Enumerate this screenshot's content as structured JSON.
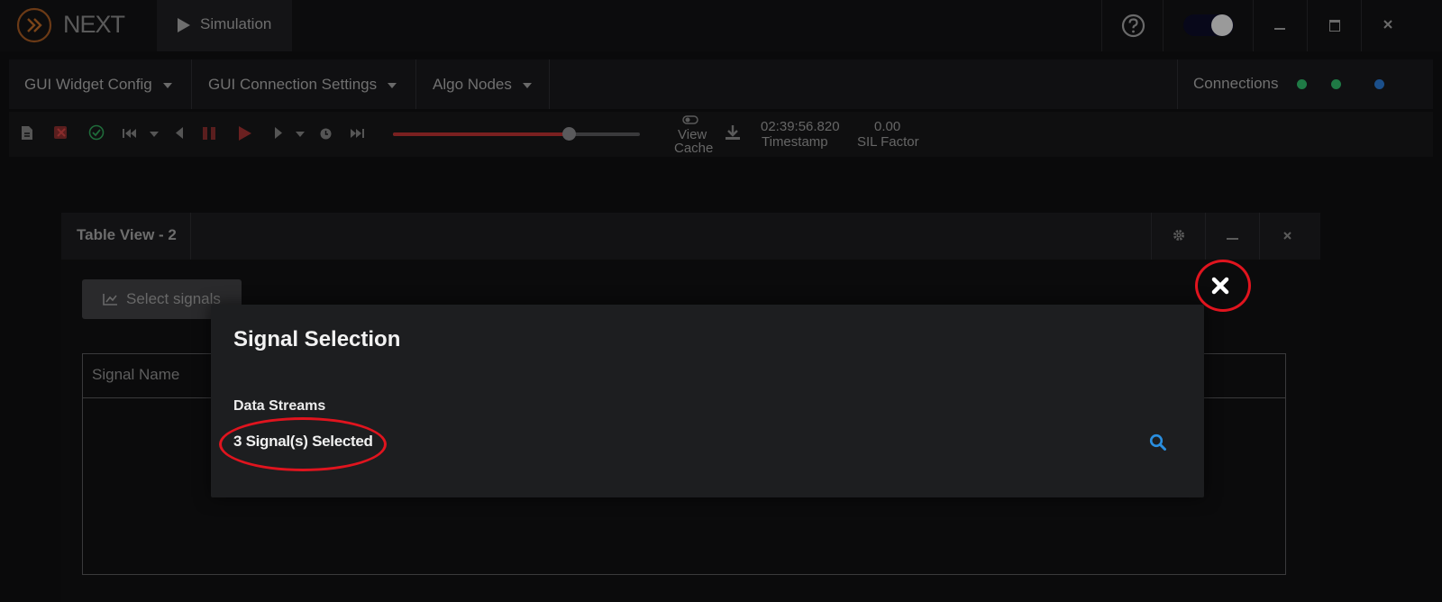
{
  "app": {
    "logo_text": "NEXT",
    "simulation_tab_label": "Simulation",
    "icons": [
      "logo-icon",
      "play-icon",
      "help-icon",
      "avatar-icon",
      "minimize-icon",
      "maximize-icon",
      "close-icon"
    ]
  },
  "menubar": {
    "items": [
      {
        "label": "GUI Widget Config"
      },
      {
        "label": "GUI Connection Settings"
      },
      {
        "label": "Algo Nodes"
      }
    ],
    "connections_label": "Connections",
    "connection_status_colors": [
      "#1f7a45",
      "#1f7a45",
      "#1b4f8a"
    ]
  },
  "toolbar": {
    "view_cache_line1": "View",
    "view_cache_line2": "Cache",
    "timestamp_value": "02:39:56.820",
    "timestamp_label": "Timestamp",
    "sil_value": "0.00",
    "sil_label": "SIL Factor",
    "progress_fraction": 0.71
  },
  "panel": {
    "title": "Table View - 2",
    "select_signals_label": "Select signals",
    "table_headers": [
      "Signal Name"
    ]
  },
  "modal": {
    "title": "Signal Selection",
    "data_streams_label": "Data Streams",
    "data_streams_value": "3 Signal(s) Selected"
  },
  "colors": {
    "annotation_red": "#e0141e",
    "search_blue": "#2a8fe0",
    "progress_red": "#7a2020"
  }
}
